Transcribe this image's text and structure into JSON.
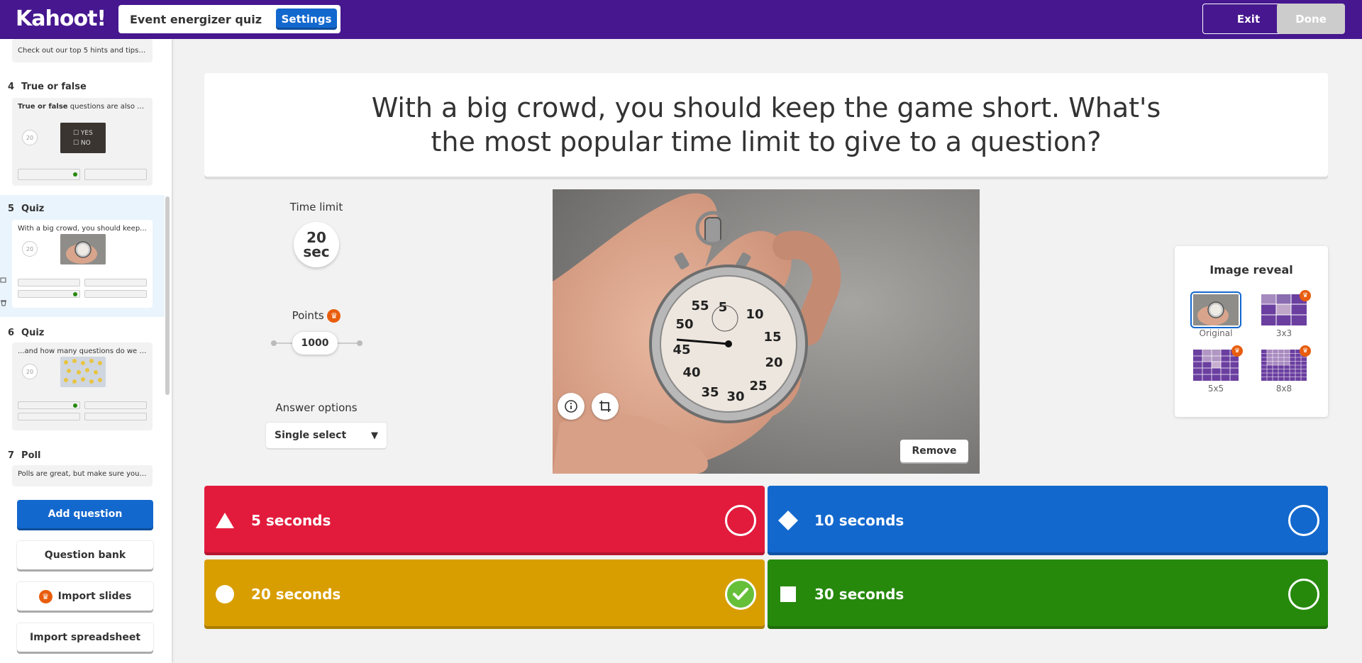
{
  "header": {
    "logo": "Kahoot!",
    "quiz_title": "Event energizer quiz",
    "settings_label": "Settings",
    "exit_label": "Exit",
    "done_label": "Done"
  },
  "sidebar": {
    "slides": [
      {
        "number": "",
        "type": "",
        "preview": "Check out our top 5 hints and tips ..."
      },
      {
        "number": "4",
        "type": "True or false",
        "preview_bold": "True or false",
        "preview": " questions are also su...",
        "timer": "20"
      },
      {
        "number": "5",
        "type": "Quiz",
        "preview": "With a big crowd, you should keep...",
        "timer": "20",
        "active": true
      },
      {
        "number": "6",
        "type": "Quiz",
        "preview": "...and how many questions do we r...",
        "timer": "20"
      },
      {
        "number": "7",
        "type": "Poll",
        "preview": "Polls are great, but make sure you ..."
      }
    ],
    "buttons": {
      "add_question": "Add question",
      "question_bank": "Question bank",
      "import_slides": "Import slides",
      "import_spreadsheet": "Import spreadsheet"
    }
  },
  "question": {
    "text": "With a big crowd, you should keep the game short. What's the most popular time limit to give to a question?"
  },
  "controls": {
    "time_limit_label": "Time limit",
    "time_limit_value": "20",
    "time_limit_unit": "sec",
    "points_label": "Points",
    "points_value": "1000",
    "answer_options_label": "Answer options",
    "answer_options_value": "Single select"
  },
  "media": {
    "remove_label": "Remove",
    "icons": [
      "info-icon",
      "crop-icon"
    ]
  },
  "image_reveal": {
    "title": "Image reveal",
    "options": [
      {
        "label": "Original",
        "selected": true
      },
      {
        "label": "3x3",
        "premium": true
      },
      {
        "label": "5x5",
        "premium": true
      },
      {
        "label": "8x8",
        "premium": true
      }
    ]
  },
  "answers": [
    {
      "text": "5 seconds",
      "color": "#e21b3c",
      "shape": "triangle-icon",
      "correct": false
    },
    {
      "text": "10 seconds",
      "color": "#1368ce",
      "shape": "diamond-icon",
      "correct": false
    },
    {
      "text": "20 seconds",
      "color": "#d89e00",
      "shape": "circle-icon",
      "correct": true
    },
    {
      "text": "30 seconds",
      "color": "#26890c",
      "shape": "square-icon",
      "correct": false
    }
  ],
  "colors": {
    "brand_purple": "#46178f",
    "primary_blue": "#1368ce",
    "premium_orange": "#e85d0d"
  }
}
